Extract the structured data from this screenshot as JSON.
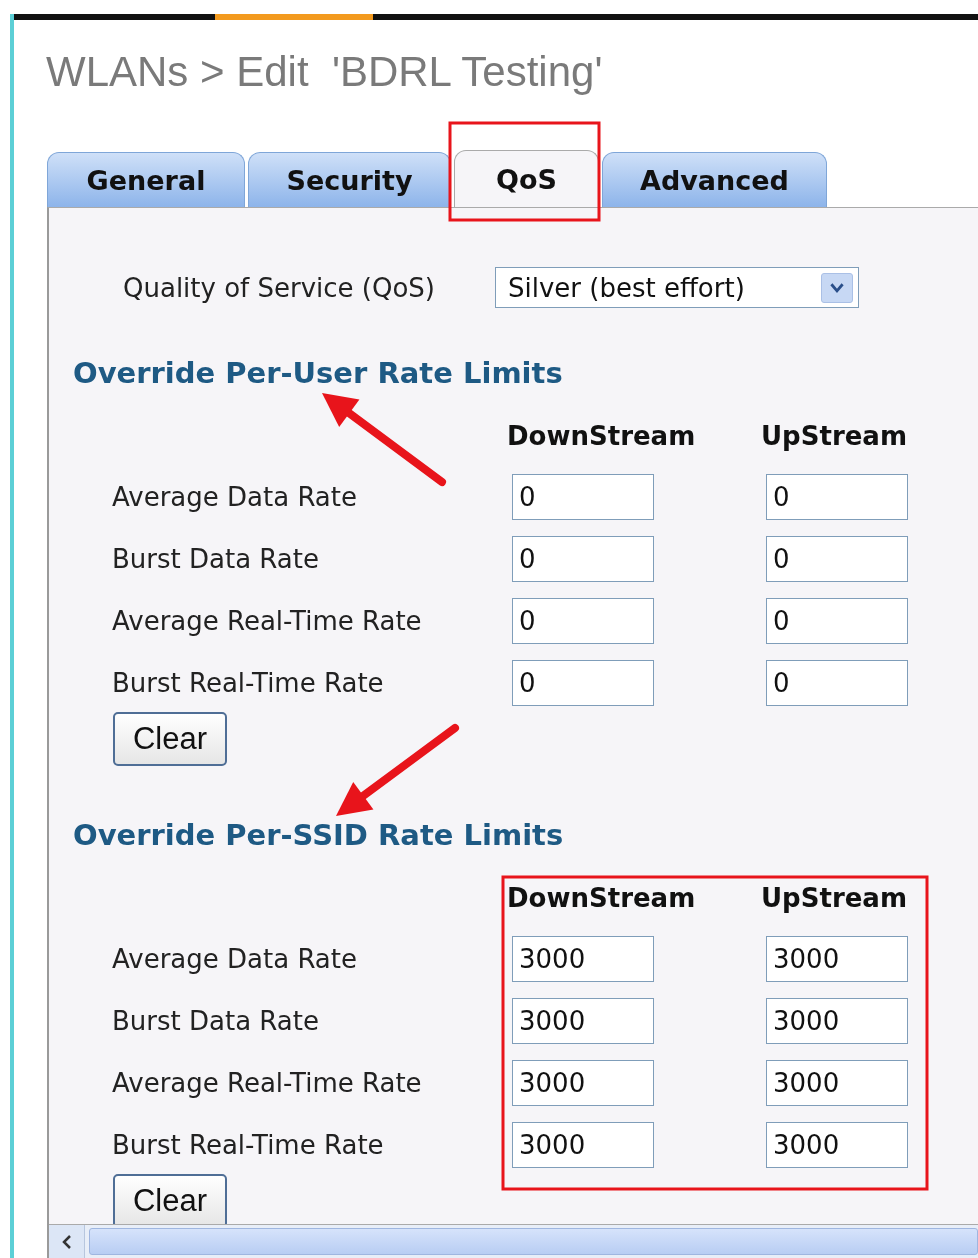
{
  "breadcrumb": "WLANs > Edit  'BDRL Testing'",
  "tabs": [
    {
      "label": "General",
      "selected": false
    },
    {
      "label": "Security",
      "selected": false
    },
    {
      "label": "QoS",
      "selected": true
    },
    {
      "label": "Advanced",
      "selected": false
    }
  ],
  "qos": {
    "label": "Quality of Service (QoS)",
    "value": "Silver (best effort)"
  },
  "sections": [
    {
      "heading": "Override Per-User Rate Limits",
      "columns": [
        "DownStream",
        "UpStream"
      ],
      "rows": [
        {
          "label": "Average Data Rate",
          "downstream": "0",
          "upstream": "0"
        },
        {
          "label": "Burst Data Rate",
          "downstream": "0",
          "upstream": "0"
        },
        {
          "label": "Average Real-Time Rate",
          "downstream": "0",
          "upstream": "0"
        },
        {
          "label": "Burst Real-Time Rate",
          "downstream": "0",
          "upstream": "0"
        }
      ],
      "button": "Clear"
    },
    {
      "heading": "Override Per-SSID Rate Limits",
      "columns": [
        "DownStream",
        "UpStream"
      ],
      "rows": [
        {
          "label": "Average Data Rate",
          "downstream": "3000",
          "upstream": "3000"
        },
        {
          "label": "Burst Data Rate",
          "downstream": "3000",
          "upstream": "3000"
        },
        {
          "label": "Average Real-Time Rate",
          "downstream": "3000",
          "upstream": "3000"
        },
        {
          "label": "Burst Real-Time Rate",
          "downstream": "3000",
          "upstream": "3000"
        }
      ],
      "button": "Clear"
    }
  ]
}
